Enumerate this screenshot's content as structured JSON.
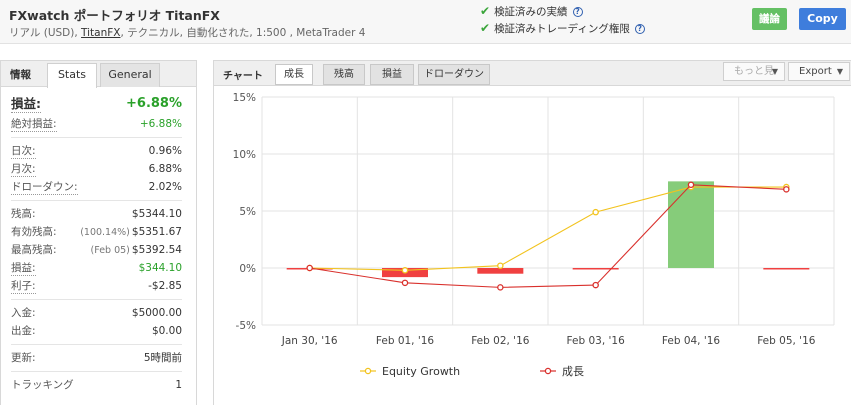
{
  "header": {
    "title": "FXwatch ポートフォリオ TitanFX",
    "sub_prefix": "リアル (USD), ",
    "sub_broker": "TitanFX",
    "sub_suffix": ", テクニカル, 自動化された, 1:500 , MetaTrader 4",
    "verified_1": "検証済みの実績",
    "verified_2": "検証済みトレーディング権限",
    "review_label": "議論",
    "copy_label": "Copy"
  },
  "left": {
    "tab_label": "情報",
    "tabs": [
      "Stats",
      "General"
    ],
    "gain_label": "損益:",
    "gain_value": "+6.88%",
    "abs_gain_label": "絶対損益:",
    "abs_gain_value": "+6.88%",
    "daily_label": "日次:",
    "daily_value": "0.96%",
    "monthly_label": "月次:",
    "monthly_value": "6.88%",
    "drawdown_label": "ドローダウン:",
    "drawdown_value": "2.02%",
    "balance_label": "残高:",
    "balance_value": "$5344.10",
    "equity_label": "有効残高:",
    "equity_note": "(100.14%)",
    "equity_value": "$5351.67",
    "highest_label": "最高残高:",
    "highest_note": "(Feb 05)",
    "highest_value": "$5392.54",
    "profit_label": "損益:",
    "profit_value": "$344.10",
    "interest_label": "利子:",
    "interest_value": "-$2.85",
    "deposits_label": "入金:",
    "deposits_value": "$5000.00",
    "withdrawals_label": "出金:",
    "withdrawals_value": "$0.00",
    "updated_label": "更新:",
    "updated_value": "5時間前",
    "tracking_label": "トラッキング",
    "tracking_value": "1"
  },
  "right": {
    "tab_label": "チャート",
    "tabs": [
      "成長",
      "残高",
      "損益",
      "ドローダウン"
    ],
    "more_label": "もっと見",
    "export_label": "Export"
  },
  "colors": {
    "equity_line": "#f2c31e",
    "growth_line": "#d9302c",
    "bar_negative": "#f04040",
    "bar_positive": "#86cc7a",
    "accent_green": "#2aa12a",
    "copy_button": "#3e7ddc",
    "review_button": "#64c064"
  },
  "chart_data": {
    "type": "line",
    "categories": [
      "Jan 30, '16",
      "Feb 01, '16",
      "Feb 02, '16",
      "Feb 03, '16",
      "Feb 04, '16",
      "Feb 05, '16"
    ],
    "ylim": [
      -5,
      15
    ],
    "yticks": [
      "-5%",
      "0%",
      "5%",
      "10%",
      "15%"
    ],
    "ytick_values": [
      -5,
      0,
      5,
      10,
      15
    ],
    "series": [
      {
        "name": "Equity Growth",
        "values": [
          0,
          -0.2,
          0.2,
          4.9,
          7.1,
          7.1
        ]
      },
      {
        "name": "成長",
        "values": [
          0,
          -1.3,
          -1.7,
          -1.5,
          7.3,
          6.9
        ]
      }
    ],
    "bars": [
      0,
      -0.8,
      -0.5,
      -0.1,
      7.6,
      -0.1
    ],
    "legend": "bottom",
    "grid": true
  }
}
